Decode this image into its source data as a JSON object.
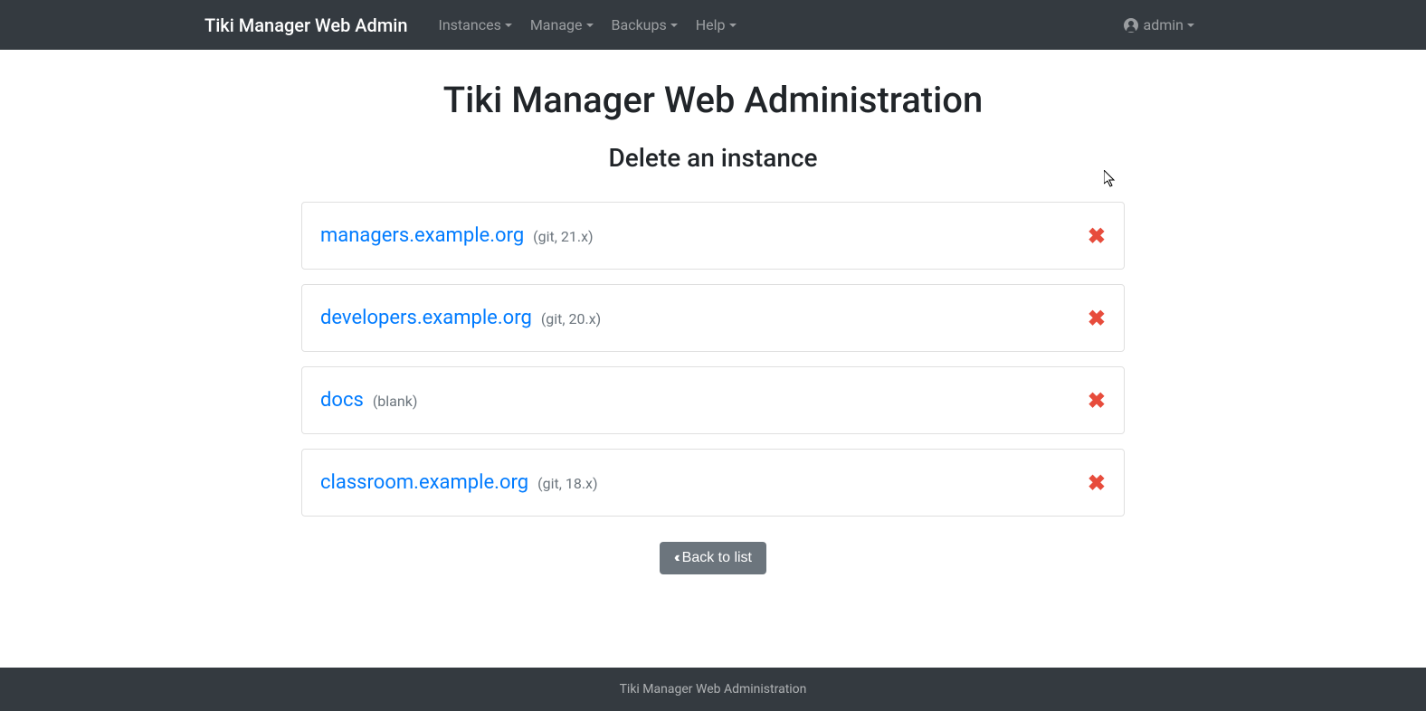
{
  "navbar": {
    "brand": "Tiki Manager Web Admin",
    "items": [
      {
        "label": "Instances"
      },
      {
        "label": "Manage"
      },
      {
        "label": "Backups"
      },
      {
        "label": "Help"
      }
    ],
    "user": "admin"
  },
  "page": {
    "title": "Tiki Manager Web Administration",
    "subtitle": "Delete an instance"
  },
  "instances": [
    {
      "name": "managers.example.org",
      "meta": "(git, 21.x)"
    },
    {
      "name": "developers.example.org",
      "meta": "(git, 20.x)"
    },
    {
      "name": "docs",
      "meta": "(blank)"
    },
    {
      "name": "classroom.example.org",
      "meta": "(git, 18.x)"
    }
  ],
  "buttons": {
    "back": "Back to list"
  },
  "footer": {
    "text": "Tiki Manager Web Administration"
  }
}
